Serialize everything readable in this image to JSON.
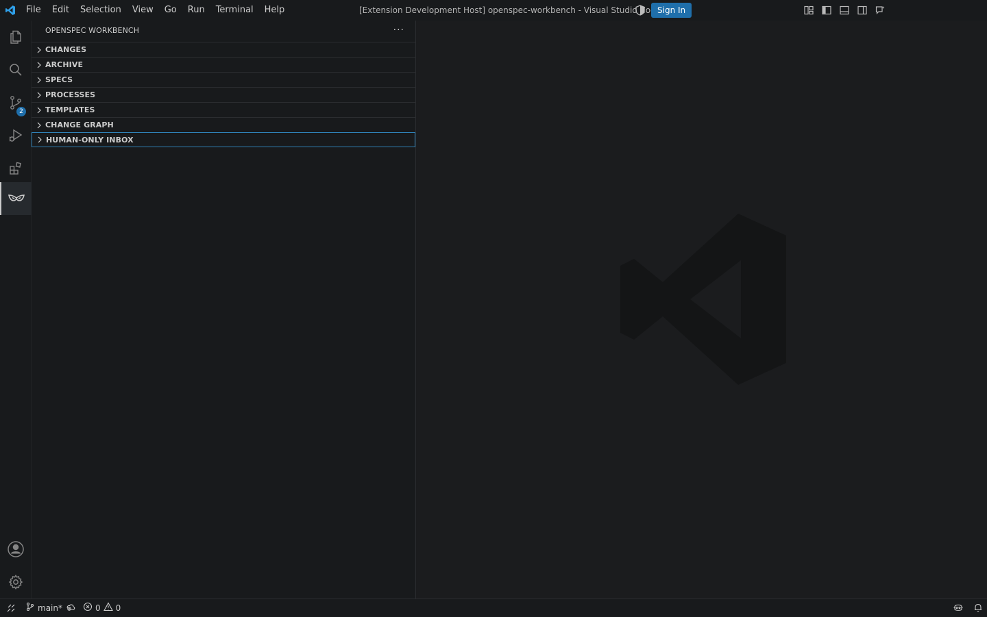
{
  "menu": [
    "File",
    "Edit",
    "Selection",
    "View",
    "Go",
    "Run",
    "Terminal",
    "Help"
  ],
  "window_title": "[Extension Development Host] openspec-workbench - Visual Studio Code",
  "sign_in_label": "Sign In",
  "activity": {
    "source_control_badge": "2"
  },
  "sidebar": {
    "title": "OPENSPEC WORKBENCH",
    "more_actions": "···",
    "sections": [
      {
        "label": "CHANGES"
      },
      {
        "label": "ARCHIVE"
      },
      {
        "label": "SPECS"
      },
      {
        "label": "PROCESSES"
      },
      {
        "label": "TEMPLATES"
      },
      {
        "label": "CHANGE GRAPH"
      },
      {
        "label": "HUMAN-ONLY INBOX"
      }
    ]
  },
  "statusbar": {
    "branch": "main*",
    "errors": "0",
    "warnings": "0"
  },
  "colors": {
    "accent": "#1f6fab",
    "focus_border": "#2f82b8",
    "background": "#181a1c",
    "editor_background": "#1b1c1e"
  }
}
